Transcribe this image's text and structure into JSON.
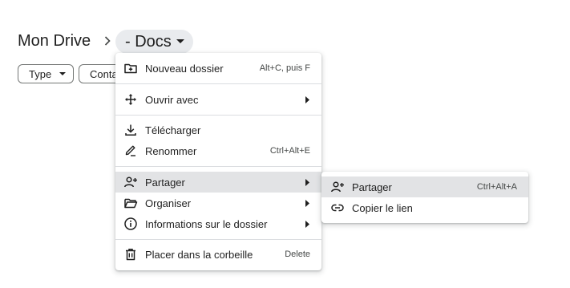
{
  "breadcrumb": {
    "root": "Mon Drive",
    "separator_icon": "chevron-right-icon",
    "current": "- Docs",
    "current_icon": "caret-down-icon"
  },
  "filters": {
    "type_label": "Type",
    "contacts_label": "Conta"
  },
  "context_menu": {
    "items": [
      {
        "label": "Nouveau dossier",
        "shortcut": "Alt+C, puis F",
        "icon": "new-folder-icon"
      },
      {
        "label": "Ouvrir avec",
        "icon": "open-with-icon",
        "submenu": true
      },
      {
        "label": "Télécharger",
        "icon": "download-icon"
      },
      {
        "label": "Renommer",
        "shortcut": "Ctrl+Alt+E",
        "icon": "rename-icon"
      },
      {
        "label": "Partager",
        "icon": "share-icon",
        "submenu": true,
        "highlighted": true
      },
      {
        "label": "Organiser",
        "icon": "organize-folder-icon",
        "submenu": true
      },
      {
        "label": "Informations sur le dossier",
        "icon": "info-icon",
        "submenu": true
      },
      {
        "label": "Placer dans la corbeille",
        "shortcut": "Delete",
        "icon": "trash-icon"
      }
    ]
  },
  "share_submenu": {
    "items": [
      {
        "label": "Partager",
        "shortcut": "Ctrl+Alt+A",
        "icon": "share-icon",
        "highlighted": true
      },
      {
        "label": "Copier le lien",
        "icon": "link-icon"
      }
    ]
  },
  "colors": {
    "text": "#1f1f1f",
    "muted": "#444746",
    "highlight": "#e2e3e5",
    "breadcrumb_pill": "#e9ebee"
  }
}
